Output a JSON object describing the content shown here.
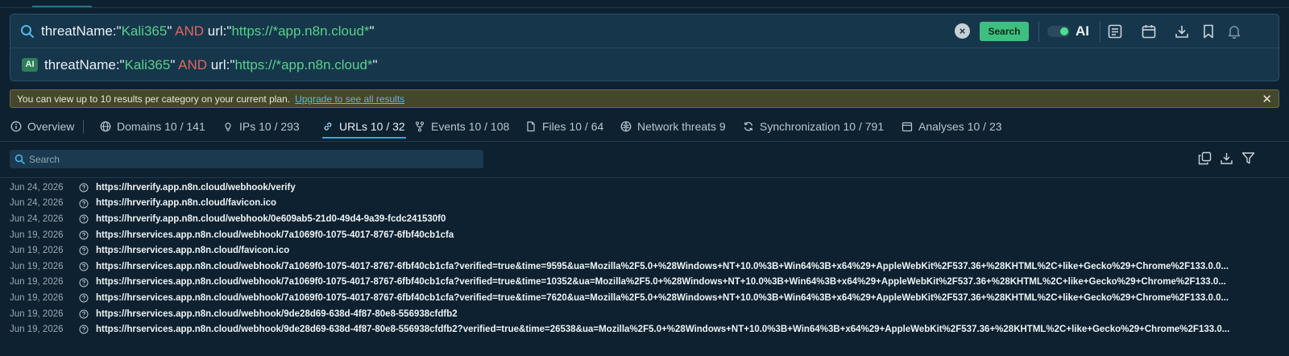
{
  "query": {
    "tokens": [
      {
        "text": "threatName:",
        "kind": "key"
      },
      {
        "text": "\"",
        "kind": "key"
      },
      {
        "text": "Kali365",
        "kind": "str"
      },
      {
        "text": "\" ",
        "kind": "key"
      },
      {
        "text": "AND",
        "kind": "op"
      },
      {
        "text": " url:",
        "kind": "key"
      },
      {
        "text": "\"",
        "kind": "key"
      },
      {
        "text": "https://*app.n8n.cloud*",
        "kind": "str"
      },
      {
        "text": "\"",
        "kind": "key"
      }
    ],
    "ai_chip_label": "AI",
    "ai_toggle_label": "AI",
    "ai_toggle_on": true,
    "search_button_label": "Search",
    "clear_icon": "clear-circle-icon",
    "toolbar_icons": [
      "notes-icon",
      "calendar-icon",
      "download-icon",
      "bookmark-icon",
      "bell-icon"
    ]
  },
  "banner": {
    "text": "You can view up to 10 results per category on your current plan.",
    "link_text": "Upgrade to see all results",
    "close_glyph": "✕",
    "colors": {
      "background": "#44472b",
      "link": "#5fb6e6"
    }
  },
  "tabs": [
    {
      "label": "Overview",
      "icon": "info-icon",
      "active": false
    },
    {
      "label": "Domains 10 / 141",
      "icon": "globe-icon",
      "active": false
    },
    {
      "label": "IPs 10 / 293",
      "icon": "lightbulb-icon",
      "active": false
    },
    {
      "label": "URLs 10 / 32",
      "icon": "link-icon",
      "active": true
    },
    {
      "label": "Events 10 / 108",
      "icon": "branch-icon",
      "active": false
    },
    {
      "label": "Files 10 / 64",
      "icon": "file-icon",
      "active": false
    },
    {
      "label": "Network threats 9",
      "icon": "network-globe-icon",
      "active": false
    },
    {
      "label": "Synchronization 10 / 791",
      "icon": "sync-icon",
      "active": false
    },
    {
      "label": "Analyses 10 / 23",
      "icon": "calendar-icon",
      "active": false
    }
  ],
  "list": {
    "search_placeholder": "Search",
    "action_icons": [
      "copy-icon",
      "download-icon",
      "filter-icon"
    ],
    "rows": [
      {
        "date": "Jun 24, 2026",
        "url": "https://hrverify.app.n8n.cloud/webhook/verify"
      },
      {
        "date": "Jun 24, 2026",
        "url": "https://hrverify.app.n8n.cloud/favicon.ico"
      },
      {
        "date": "Jun 24, 2026",
        "url": "https://hrverify.app.n8n.cloud/webhook/0e609ab5-21d0-49d4-9a39-fcdc241530f0"
      },
      {
        "date": "Jun 19, 2026",
        "url": "https://hrservices.app.n8n.cloud/webhook/7a1069f0-1075-4017-8767-6fbf40cb1cfa"
      },
      {
        "date": "Jun 19, 2026",
        "url": "https://hrservices.app.n8n.cloud/favicon.ico"
      },
      {
        "date": "Jun 19, 2026",
        "url": "https://hrservices.app.n8n.cloud/webhook/7a1069f0-1075-4017-8767-6fbf40cb1cfa?verified=true&time=9595&ua=Mozilla%2F5.0+%28Windows+NT+10.0%3B+Win64%3B+x64%29+AppleWebKit%2F537.36+%28KHTML%2C+like+Gecko%29+Chrome%2F133.0.0..."
      },
      {
        "date": "Jun 19, 2026",
        "url": "https://hrservices.app.n8n.cloud/webhook/7a1069f0-1075-4017-8767-6fbf40cb1cfa?verified=true&time=10352&ua=Mozilla%2F5.0+%28Windows+NT+10.0%3B+Win64%3B+x64%29+AppleWebKit%2F537.36+%28KHTML%2C+like+Gecko%29+Chrome%2F133.0..."
      },
      {
        "date": "Jun 19, 2026",
        "url": "https://hrservices.app.n8n.cloud/webhook/7a1069f0-1075-4017-8767-6fbf40cb1cfa?verified=true&time=7620&ua=Mozilla%2F5.0+%28Windows+NT+10.0%3B+Win64%3B+x64%29+AppleWebKit%2F537.36+%28KHTML%2C+like+Gecko%29+Chrome%2F133.0.0..."
      },
      {
        "date": "Jun 19, 2026",
        "url": "https://hrservices.app.n8n.cloud/webhook/9de28d69-638d-4f87-80e8-556938cfdfb2"
      },
      {
        "date": "Jun 19, 2026",
        "url": "https://hrservices.app.n8n.cloud/webhook/9de28d69-638d-4f87-80e8-556938cfdfb2?verified=true&time=26538&ua=Mozilla%2F5.0+%28Windows+NT+10.0%3B+Win64%3B+x64%29+AppleWebKit%2F537.36+%28KHTML%2C+like+Gecko%29+Chrome%2F133.0..."
      }
    ]
  },
  "colors": {
    "background": "#0d2130",
    "panel": "#16364b",
    "accent_green": "#3fbf7f",
    "string_token": "#58d08a",
    "operator_token": "#e0675f",
    "active_tab_underline": "#3aa6d9"
  }
}
